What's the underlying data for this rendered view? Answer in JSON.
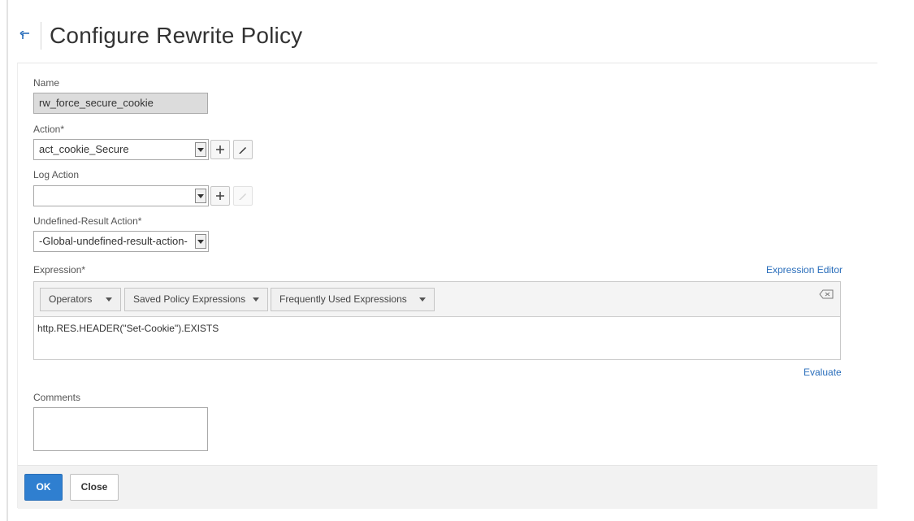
{
  "page": {
    "title": "Configure Rewrite Policy"
  },
  "fields": {
    "name": {
      "label": "Name",
      "value": "rw_force_secure_cookie"
    },
    "action": {
      "label": "Action*",
      "value": "act_cookie_Secure"
    },
    "log_action": {
      "label": "Log Action",
      "value": ""
    },
    "undefined_result_action": {
      "label": "Undefined-Result Action*",
      "value": "-Global-undefined-result-action-"
    },
    "expression": {
      "label": "Expression*",
      "editor_link": "Expression Editor",
      "toolbar": {
        "operators": "Operators",
        "saved": "Saved Policy Expressions",
        "frequent": "Frequently Used Expressions"
      },
      "value": "http.RES.HEADER(\"Set-Cookie\").EXISTS",
      "evaluate_link": "Evaluate"
    },
    "comments": {
      "label": "Comments",
      "value": ""
    }
  },
  "buttons": {
    "add_symbol": "+",
    "ok": "OK",
    "close": "Close"
  },
  "icons": {
    "back": "back-arrow-icon",
    "add": "plus-icon",
    "edit": "pencil-icon",
    "clear": "backspace-clear-icon",
    "dropdown": "caret-down-icon"
  },
  "colors": {
    "accent": "#2a6ebb",
    "primary_button": "#2f7fd0",
    "disabled_field": "#dcdcdc"
  }
}
